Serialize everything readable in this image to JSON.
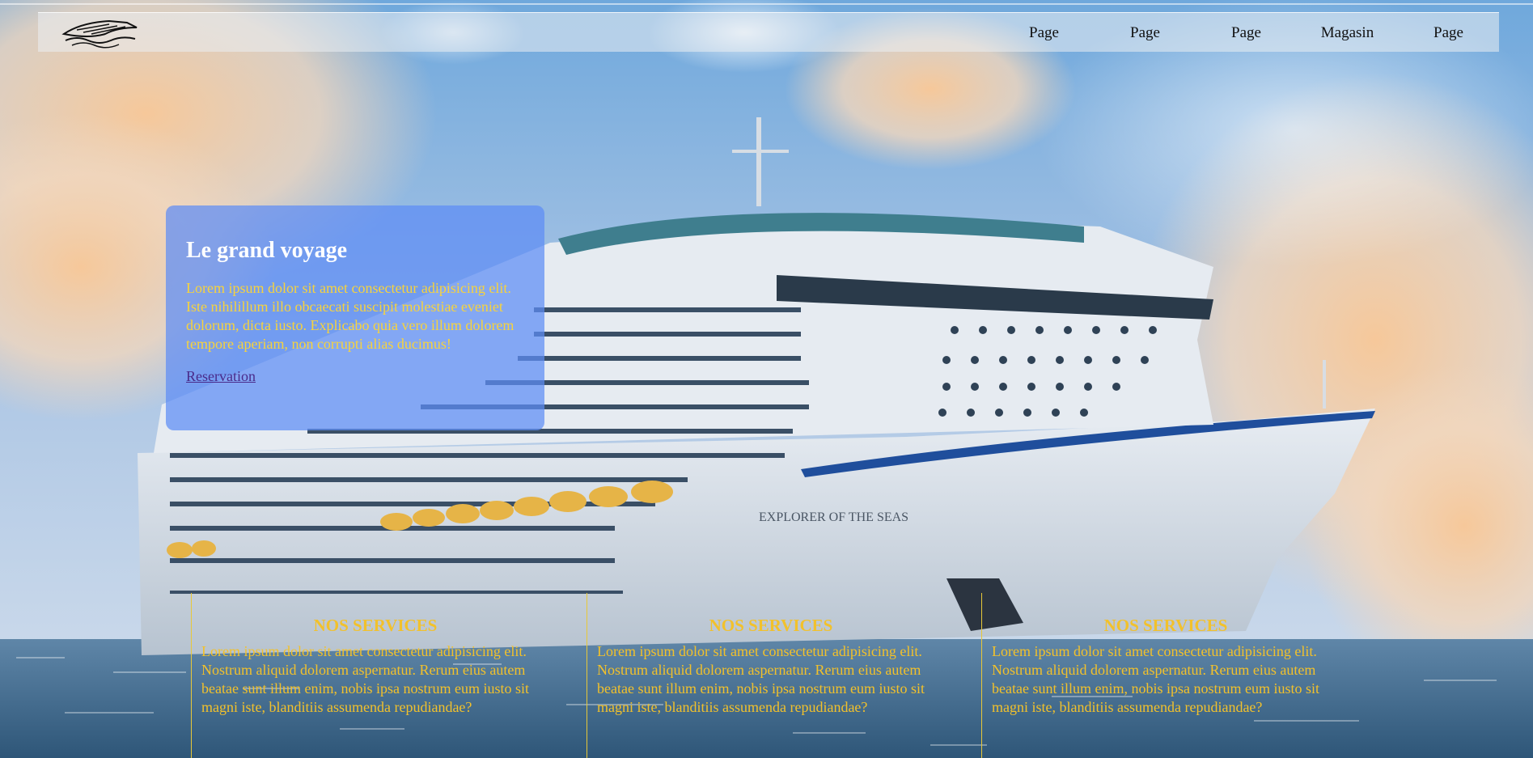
{
  "nav": {
    "logo": "ship-logo-icon",
    "links": [
      {
        "label": "Page"
      },
      {
        "label": "Page"
      },
      {
        "label": "Page"
      },
      {
        "label": "Magasin"
      },
      {
        "label": "Page"
      }
    ]
  },
  "hero": {
    "title": "Le grand voyage",
    "text": "Lorem ipsum dolor sit amet consectetur adipisicing elit. Iste nihilillum illo obcaecati suscipit molestiae eveniet dolorum, dicta iusto. Explicabo quia vero illum dolorem tempore aperiam, non corrupti alias ducimus!",
    "link": "Reservation"
  },
  "services": [
    {
      "title": "NOS SERVICES",
      "text": "Lorem ipsum dolor sit amet consectetur adipisicing elit. Nostrum aliquid dolorem aspernatur. Rerum eius autem beatae sunt illum enim, nobis ipsa nostrum eum iusto sit magni iste, blanditiis assumenda repudiandae?"
    },
    {
      "title": "NOS SERVICES",
      "text": "Lorem ipsum dolor sit amet consectetur adipisicing elit. Nostrum aliquid dolorem aspernatur. Rerum eius autem beatae sunt illum enim, nobis ipsa nostrum eum iusto sit magni iste, blanditiis assumenda repudiandae?"
    },
    {
      "title": "NOS SERVICES",
      "text": "Lorem ipsum dolor sit amet consectetur adipisicing elit. Nostrum aliquid dolorem aspernatur. Rerum eius autem beatae sunt illum enim, nobis ipsa nostrum eum iusto sit magni iste, blanditiis assumenda repudiandae?"
    }
  ],
  "ship_name": "EXPLORER OF THE SEAS",
  "colors": {
    "accent_yellow": "#f2c12b",
    "card_blue": "#5d8cf5",
    "link_purple": "#4a2a8a"
  }
}
